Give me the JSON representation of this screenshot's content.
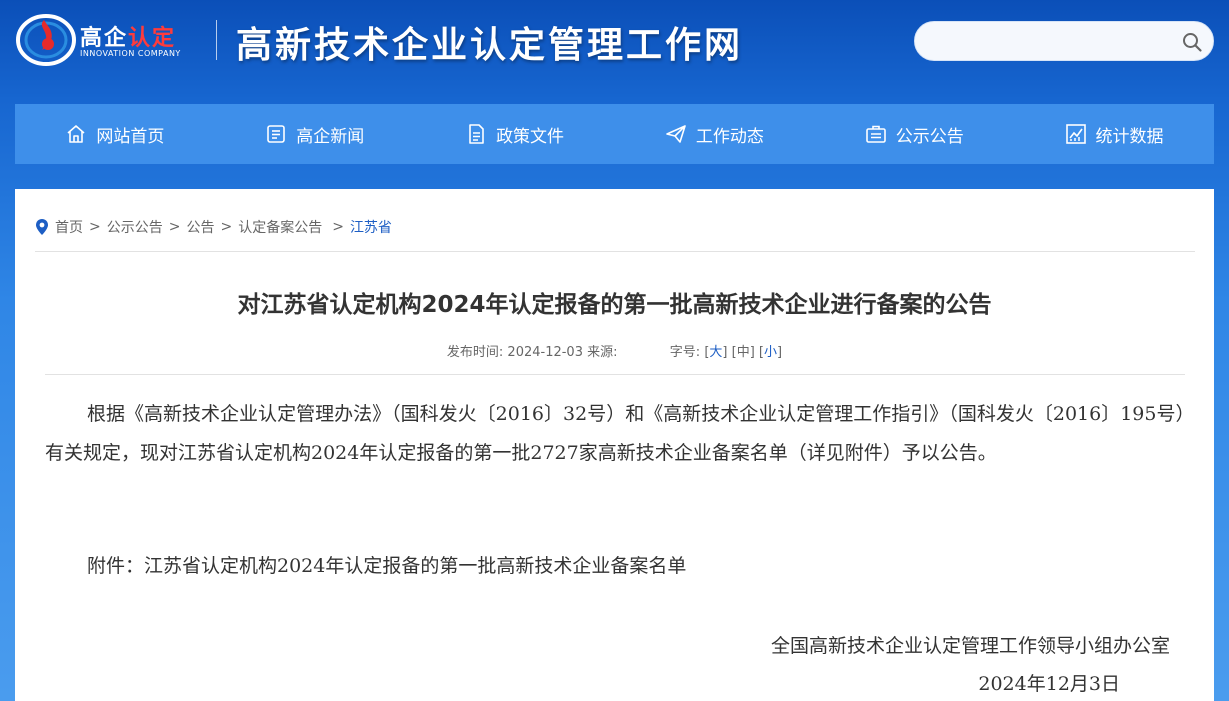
{
  "header": {
    "logo_text_main": "高企",
    "logo_text_accent": "认定",
    "logo_sub": "INNOVATION COMPANY",
    "site_title": "高新技术企业认定管理工作网",
    "search_placeholder": ""
  },
  "nav": [
    {
      "label": "网站首页",
      "icon": "home-icon"
    },
    {
      "label": "高企新闻",
      "icon": "news-icon"
    },
    {
      "label": "政策文件",
      "icon": "document-icon"
    },
    {
      "label": "工作动态",
      "icon": "paper-plane-icon"
    },
    {
      "label": "公示公告",
      "icon": "briefcase-icon"
    },
    {
      "label": "统计数据",
      "icon": "chart-icon"
    }
  ],
  "breadcrumb": {
    "items": [
      "首页",
      "公示公告",
      "公告",
      "认定备案公告"
    ],
    "current": "江苏省",
    "separator": ">"
  },
  "article": {
    "title": "对江苏省认定机构2024年认定报备的第一批高新技术企业进行备案的公告",
    "publish_label": "发布时间:",
    "publish_date": "2024-12-03",
    "source_label": "来源:",
    "font_size_label": "字号:",
    "size_large": "大",
    "size_medium": "中",
    "size_small": "小",
    "body": "根据《高新技术企业认定管理办法》（国科发火〔2016〕32号）和《高新技术企业认定管理工作指引》（国科发火〔2016〕195号）有关规定，现对江苏省认定机构2024年认定报备的第一批2727家高新技术企业备案名单（详见附件）予以公告。",
    "attachment": "附件：江苏省认定机构2024年认定报备的第一批高新技术企业备案名单",
    "signature_org": "全国高新技术企业认定管理工作领导小组办公室",
    "signature_date": "2024年12月3日"
  },
  "colors": {
    "nav_bg": "#3e8fea",
    "link": "#1d5ec4",
    "logo_red": "#ff3b3b"
  }
}
